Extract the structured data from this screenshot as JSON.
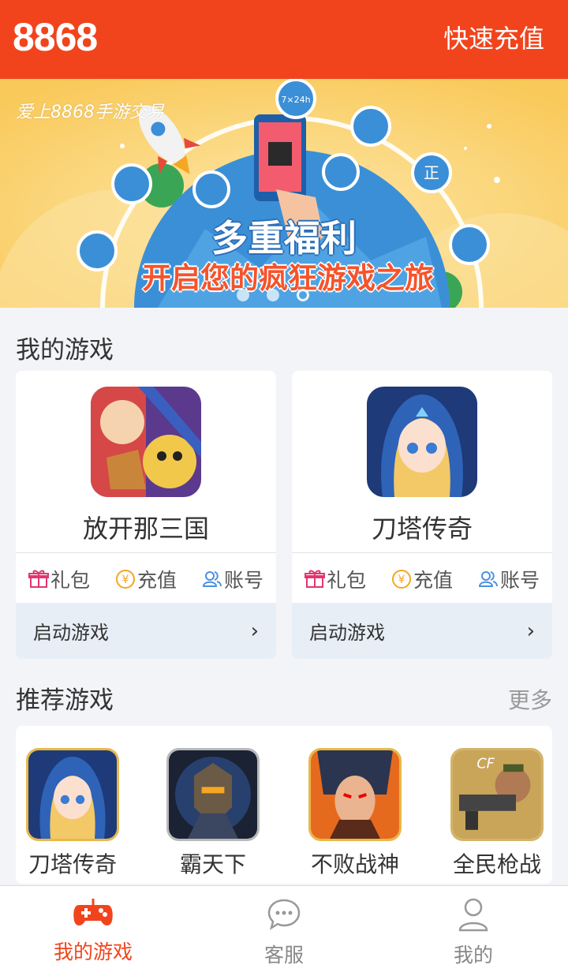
{
  "header": {
    "logo": "8868",
    "recharge_label": "快速充值"
  },
  "banner": {
    "brand_text": "爱上8868手游交易",
    "title": "多重福利",
    "subtitle": "开启您的疯狂游戏之旅",
    "badge_text": "7×24h",
    "shield_text": "正",
    "slide_count": 3,
    "active_slide": 3
  },
  "my_games": {
    "title": "我的游戏",
    "cards": [
      {
        "name": "放开那三国",
        "gift": "礼包",
        "recharge": "充值",
        "account": "账号",
        "launch": "启动游戏"
      },
      {
        "name": "刀塔传奇",
        "gift": "礼包",
        "recharge": "充值",
        "account": "账号",
        "launch": "启动游戏"
      }
    ]
  },
  "recommended": {
    "title": "推荐游戏",
    "more": "更多",
    "items": [
      {
        "name": "刀塔传奇"
      },
      {
        "name": "霸天下"
      },
      {
        "name": "不败战神"
      },
      {
        "name": "全民枪战"
      }
    ]
  },
  "tabbar": {
    "tabs": [
      {
        "label": "我的游戏",
        "active": true
      },
      {
        "label": "客服",
        "active": false
      },
      {
        "label": "我的",
        "active": false
      }
    ]
  },
  "colors": {
    "brand": "#f1441d",
    "gift": "#e2366f",
    "coin": "#f5a623",
    "account": "#4a90e2"
  }
}
